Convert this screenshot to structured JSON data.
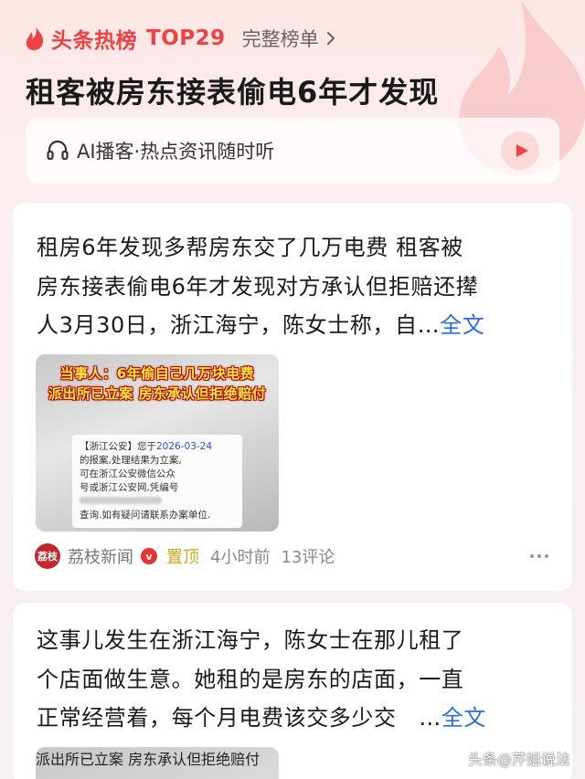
{
  "header": {
    "brand": "头条热榜",
    "rank": "TOP29",
    "full_list_label": "完整榜单",
    "headline": "租客被房东接表偷电6年才发现"
  },
  "podcast": {
    "label": "AI播客·热点资讯随时听"
  },
  "articles": [
    {
      "lines": [
        "租房6年发现多帮房东交了几万电费 租客被",
        "房东接表偷电6年才发现对方承认但拒赔还撵",
        "人3月30日，浙江海宁，陈女士称，自"
      ],
      "ellipsis": "…",
      "more_label": "全文",
      "thumb_caption_1": "当事人：6年偷自己几万块电费",
      "thumb_caption_2": "派出所已立案 房东承认但拒绝赔付",
      "notice_line_1_prefix": "【浙江公安】您于",
      "notice_date": "2026-03-24",
      "notice_line_2": "的报案,处理结果为立案,",
      "notice_line_3": "可在浙江公安微信公众",
      "notice_line_4": "号或浙江公安网,凭编号",
      "notice_line_6": "查询.如有疑问请联系办案单位.",
      "source_logo": "荔枝",
      "source": "荔枝新闻",
      "verified_mark": "v",
      "pinned": "置顶",
      "time": "4小时前",
      "comments": "13评论"
    },
    {
      "lines": [
        "这事儿发生在浙江海宁，陈女士在那儿租了",
        "个店面做生意。她租的是房东的店面，一直",
        "正常经营着，每个月电费该交多少交"
      ],
      "ellipsis": "…",
      "more_label": "全文",
      "thumb_caption_1": "派出所已立案 房东承认但拒绝赔付"
    }
  ],
  "watermark": "头条@芹姐说法",
  "colors": {
    "accent": "#f04142",
    "link": "#2a6ed8",
    "pinned": "#e0a11a"
  }
}
